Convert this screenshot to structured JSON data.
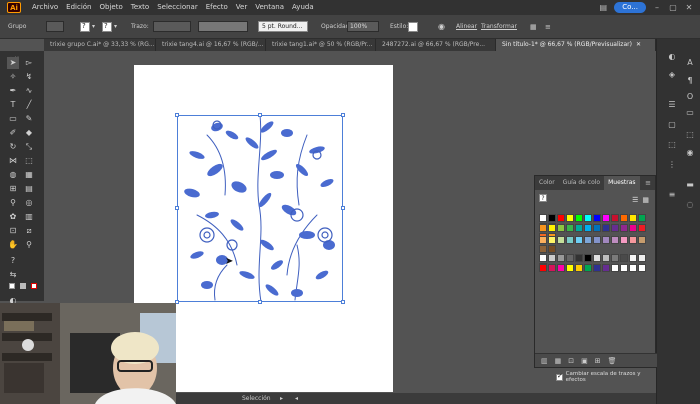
{
  "app": {
    "logo": "Ai"
  },
  "menu": [
    "Archivo",
    "Edición",
    "Objeto",
    "Texto",
    "Seleccionar",
    "Efecto",
    "Ver",
    "Ventana",
    "Ayuda"
  ],
  "user_button": "Co...",
  "control": {
    "group_label": "Grupo",
    "stroke_label": "Trazo:",
    "brush_value": "5 pt. Round...",
    "opacity_label": "Opacidad:",
    "opacity_value": "100%",
    "style_label": "Estilo:",
    "align_label": "Alinear",
    "transform_label": "Transformar"
  },
  "tabs": [
    {
      "label": "trixie grupo C.ai* @ 33,33 % (RG...",
      "active": false
    },
    {
      "label": "trixie tang4.ai @ 16,67 % (RGB/...",
      "active": false
    },
    {
      "label": "trixie tang1.ai* @ 50 % (RGB/Pr...",
      "active": false
    },
    {
      "label": "2487272.ai @ 66,67 % (RGB/Pre...",
      "active": false
    },
    {
      "label": "Sin título-1* @ 66,67 % (RGB/Previsualizar)",
      "active": true
    }
  ],
  "swatches_panel": {
    "tabs": [
      "Color",
      "Guía de colo",
      "Muestras"
    ],
    "active_tab": "Muestras",
    "row1_colors": [
      "#ffffff",
      "#000000",
      "#ff0000",
      "#ffff00",
      "#00ff00",
      "#00ffff",
      "#0000ff",
      "#ff00ff",
      "#c8102e",
      "#ff6a00",
      "#ffe600",
      "#00a651",
      "#ff0000",
      "#ed145b"
    ],
    "row2_colors": [
      "#f7941d",
      "#fff200",
      "#8dc63f",
      "#39b54a",
      "#00a99d",
      "#00aeef",
      "#0072bc",
      "#2e3192",
      "#662d91",
      "#92278f",
      "#ec008c",
      "#ed1c24",
      "#f26522",
      "#f7941d"
    ],
    "row3_colors": [
      "#fbaf5d",
      "#fff568",
      "#c4df9b",
      "#7accc8",
      "#6dcff6",
      "#7da7d9",
      "#8393ca",
      "#a187be",
      "#bd8cbf",
      "#f49ac2",
      "#f6989d",
      "#c69c6d",
      "#8c6239",
      "#754c24"
    ],
    "row4_colors": [
      "#ffffff",
      "#cccccc",
      "#999999",
      "#666666",
      "#333333",
      "#000000",
      "#e0e0e0",
      "#bdbdbd",
      "#7a7a7a",
      "#4a4a4a",
      "#f5f5f5",
      "#eeeeee",
      "#dddddd"
    ],
    "row5_colors": [
      "#ff0000",
      "#d4145a",
      "#ff00aa",
      "#ffff00",
      "#ffcc00",
      "#00a651",
      "#2e3192",
      "#662d91",
      "#ffffff",
      "#ffffff",
      "#ffffff",
      "#ffffff"
    ],
    "checkbox_label": "Cambiar escala de trazos y efectos"
  },
  "status": {
    "tool": "Selección"
  }
}
